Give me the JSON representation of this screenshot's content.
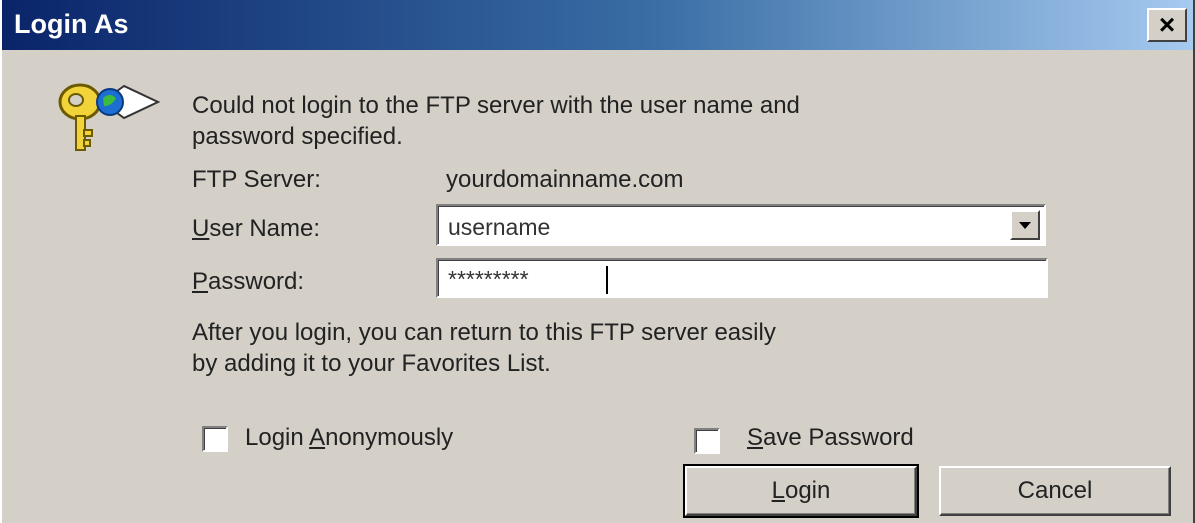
{
  "window": {
    "title": "Login As",
    "close_label": "×"
  },
  "message": {
    "line1": "Could not login to the FTP server with the user name and",
    "line2": "password specified."
  },
  "server": {
    "label": "FTP Server:",
    "value": "yourdomainname.com"
  },
  "username": {
    "label_underlined": "U",
    "label_rest": "ser Name:",
    "value": "username"
  },
  "password": {
    "label_underlined": "P",
    "label_rest": "assword:",
    "value": "*********"
  },
  "info": {
    "line1": "After you login, you can return to this FTP server easily",
    "line2": "by adding it to your Favorites List."
  },
  "options": {
    "anon_pre": "Login ",
    "anon_underlined": "A",
    "anon_rest": "nonymously",
    "save_underlined": "S",
    "save_rest": "ave Password"
  },
  "buttons": {
    "login_underlined": "L",
    "login_rest": "ogin",
    "cancel": "Cancel"
  },
  "icons": {
    "key": "key-icon",
    "dropdown": "chevron-down-icon",
    "close": "close-icon"
  }
}
